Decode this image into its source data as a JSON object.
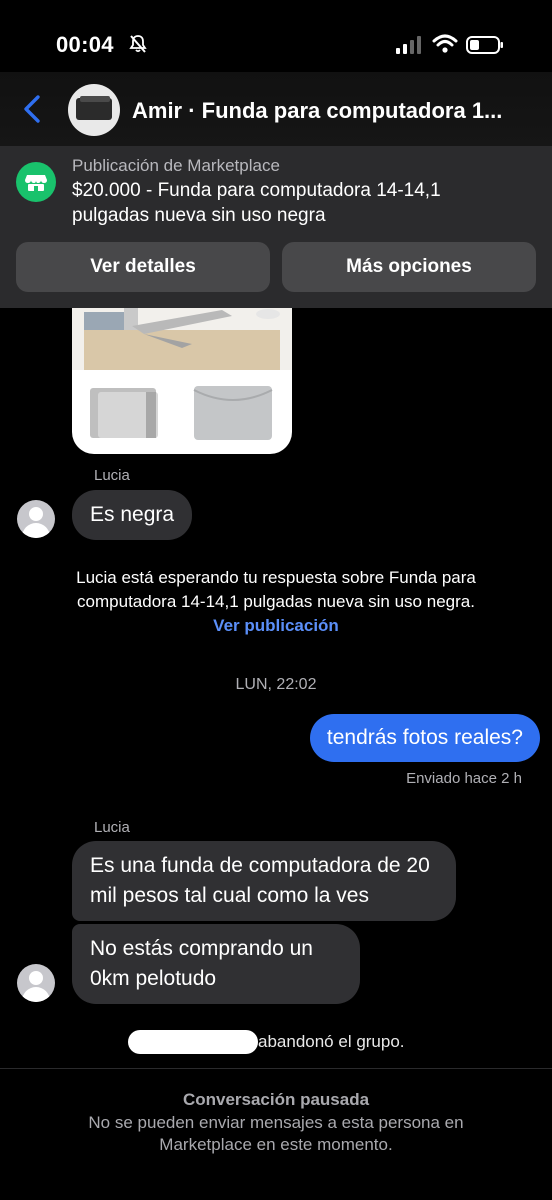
{
  "status_bar": {
    "time": "00:04"
  },
  "header": {
    "title": "Amir · Funda para computadora 1..."
  },
  "banner": {
    "kicker": "Publicación de Marketplace",
    "description": "$20.000 - Funda para computadora 14-14,1 pulgadas nueva sin uso negra",
    "details_button": "Ver detalles",
    "options_button": "Más opciones"
  },
  "messages": {
    "sender_1": "Lucia",
    "msg_1": "Es negra",
    "system_wait": "Lucia está esperando tu respuesta sobre Funda para computadora 14-14,1 pulgadas nueva sin uso negra.",
    "view_post": "Ver publicación",
    "timestamp": "LUN, 22:02",
    "outgoing": "tendrás fotos reales?",
    "sent_status": "Enviado hace 2 h",
    "sender_2": "Lucia",
    "msg_2": "Es una funda de computadora de 20 mil pesos tal cual como la ves",
    "msg_3": "No estás comprando un 0km pelotudo",
    "left_group": "abandonó el grupo."
  },
  "footer": {
    "paused_title": "Conversación pausada",
    "paused_desc": "No se pueden enviar mensajes a esta persona en Marketplace en este momento."
  },
  "colors": {
    "accent": "#2f6ff0",
    "link": "#5b8ff9",
    "marketplace": "#19c26c",
    "bubble_in": "#303033"
  },
  "icons": [
    "bell-slash-icon",
    "signal-icon",
    "wifi-icon",
    "battery-icon",
    "back-chevron-icon",
    "storefront-icon",
    "user-avatar-icon"
  ]
}
